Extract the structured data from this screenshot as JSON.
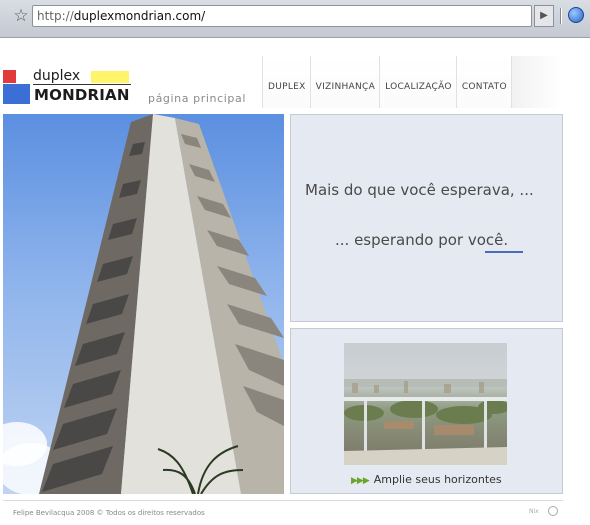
{
  "browser": {
    "url_scheme": "http://",
    "url_host": "duplexmondrian.com",
    "url_path": "/"
  },
  "logo": {
    "line1": "duplex",
    "line2": "MONDRIAN"
  },
  "subtitle": "página principal",
  "nav": {
    "items": [
      {
        "label": "DUPLEX"
      },
      {
        "label": "VIZINHANÇA"
      },
      {
        "label": "LOCALIZAÇÃO"
      },
      {
        "label": "CONTATO"
      }
    ]
  },
  "tagline": {
    "line1": "Mais do que você esperava, ...",
    "line2": "... esperando por você."
  },
  "promo": {
    "label": "Amplie seus horizontes"
  },
  "footer": {
    "copyright": "Felipe Bevilacqua 2008 © Todos os direitos reservados",
    "credit": "Nix"
  },
  "colors": {
    "logo_red": "#e03a3a",
    "logo_blue": "#3b6fd6",
    "logo_yellow": "#fff46a",
    "panel_bg": "#e4e9f2",
    "promo_arrow": "#6aa52a"
  }
}
